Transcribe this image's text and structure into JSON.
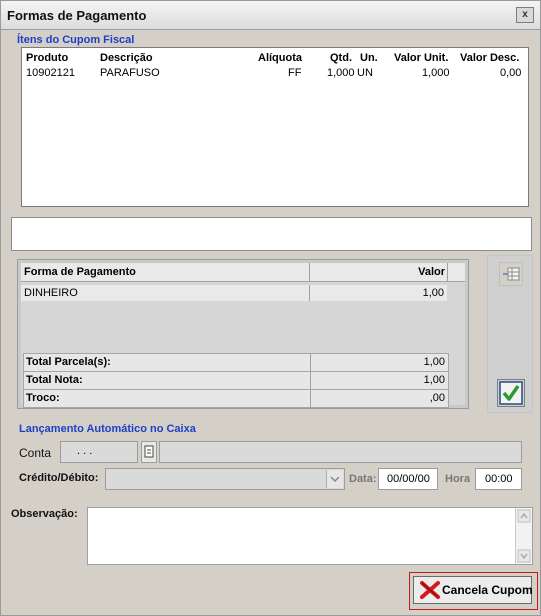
{
  "window": {
    "title": "Formas de Pagamento",
    "close_label": "x"
  },
  "items_group": {
    "title": "Ítens do Cupom Fiscal",
    "headers": {
      "produto": "Produto",
      "descricao": "Descrição",
      "aliquota": "Alíquota",
      "qtd": "Qtd.",
      "un": "Un.",
      "valor_unit": "Valor Unit.",
      "valor_desc": "Valor Desc."
    },
    "rows": [
      {
        "produto": "10902121",
        "descricao": "PARAFUSO",
        "aliquota": "FF",
        "qtd": "1,000",
        "un": "UN",
        "valor_unit": "1,000",
        "valor_desc": "0,00"
      }
    ]
  },
  "payments": {
    "headers": {
      "forma": "Forma de Pagamento",
      "valor": "Valor"
    },
    "rows": [
      {
        "forma": "DINHEIRO",
        "valor": "1,00"
      }
    ],
    "totals": [
      {
        "label": "Total Parcela(s):",
        "value": "1,00"
      },
      {
        "label": "Total Nota:",
        "value": "1,00"
      },
      {
        "label": "Troco:",
        "value": ",00"
      }
    ]
  },
  "lancamento": {
    "title": "Lançamento Automático no Caixa",
    "conta_label": "Conta",
    "conta_value": ". . .",
    "credito_label": "Crédito/Débito:",
    "data_label": "Data:",
    "data_value": "00/00/00",
    "hora_label": "Hora",
    "hora_value": "00:00"
  },
  "observacao": {
    "label": "Observação:"
  },
  "actions": {
    "cancel_label": "Cancela Cupom"
  },
  "icons": {
    "grid": "grid-icon",
    "confirm": "check-icon",
    "lookup": "lookup-icon",
    "cancel": "red-x-icon"
  },
  "colors": {
    "group_title": "#1e3ec8",
    "confirm_green": "#2e9a2e",
    "cancel_red": "#c71919"
  }
}
